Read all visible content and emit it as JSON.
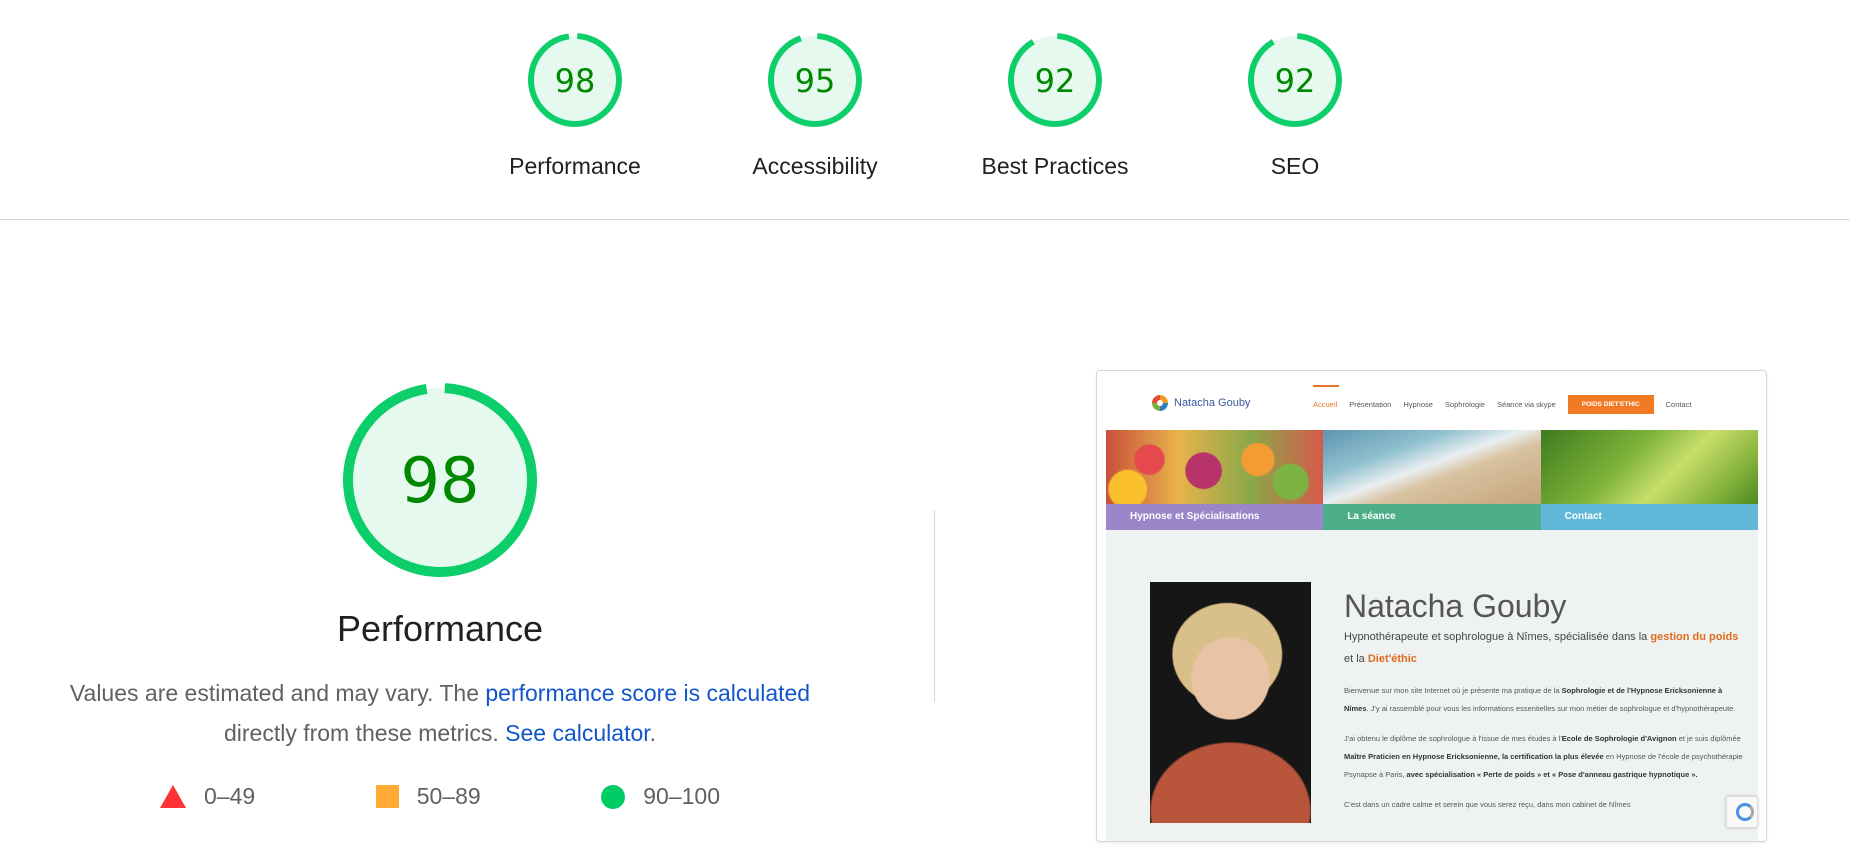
{
  "summary": {
    "gauges": [
      {
        "score": "98",
        "label": "Performance",
        "fraction": 0.98
      },
      {
        "score": "95",
        "label": "Accessibility",
        "fraction": 0.95
      },
      {
        "score": "92",
        "label": "Best Practices",
        "fraction": 0.92
      },
      {
        "score": "92",
        "label": "SEO",
        "fraction": 0.92
      }
    ]
  },
  "performance": {
    "score": "98",
    "fraction": 0.98,
    "title": "Performance",
    "desc_prefix": "Values are estimated and may vary. The ",
    "desc_link": "performance score is calculated",
    "desc_mid": " directly from these metrics. ",
    "calculator_link": "See calculator",
    "desc_suffix": "."
  },
  "legend": {
    "fail": "0–49",
    "average": "50–89",
    "pass": "90–100"
  },
  "colors": {
    "pass": "#0cce6b",
    "pass_bg": "#e6f9ee",
    "pass_text": "#008800",
    "average": "#ffaa33",
    "fail": "#ff3333",
    "link": "#1155cc"
  },
  "screenshot": {
    "logo_text": "Natacha Gouby",
    "nav": [
      "Accueil",
      "Présentation",
      "Hypnose",
      "Sophrologie",
      "Séance via skype",
      "POIDS DIET'ETHIC",
      "Contact"
    ],
    "banners": [
      "Hypnose et Spécialisations",
      "La séance",
      "Contact"
    ],
    "heading": "Natacha Gouby",
    "subtitle_a": "Hypnothérapeute et sophrologue à Nîmes, spécialisée dans la ",
    "subtitle_b": "gestion du poids",
    "subtitle_c": " et la ",
    "subtitle_d": "Diet'éthic",
    "p1_a": "Bienvenue sur mon site Internet où je présente ma pratique de la ",
    "p1_b": "Sophrologie et de l'Hypnose Ericksonienne à Nîmes",
    "p1_c": ". J'y ai rassemblé pour vous les informations essentielles sur mon métier de sophrologue et d'hypnothérapeute.",
    "p2_a": "J'ai obtenu le diplôme de sophrologue à l'issue de mes études à l'",
    "p2_b": "Ecole de Sophrologie d'Avignon",
    "p2_c": " et je suis diplômée ",
    "p2_d": "Maître Praticien en Hypnose Ericksonienne, la certification la plus élevée",
    "p2_e": " en Hypnose de l'école de psychothérapie Psynapse à Paris, ",
    "p2_f": "avec spécialisation « Perte de poids » et « Pose d'anneau gastrique hypnotique ».",
    "p3": "C'est dans un cadre calme et serein que vous serez reçu, dans mon cabinet de Nîmes"
  }
}
